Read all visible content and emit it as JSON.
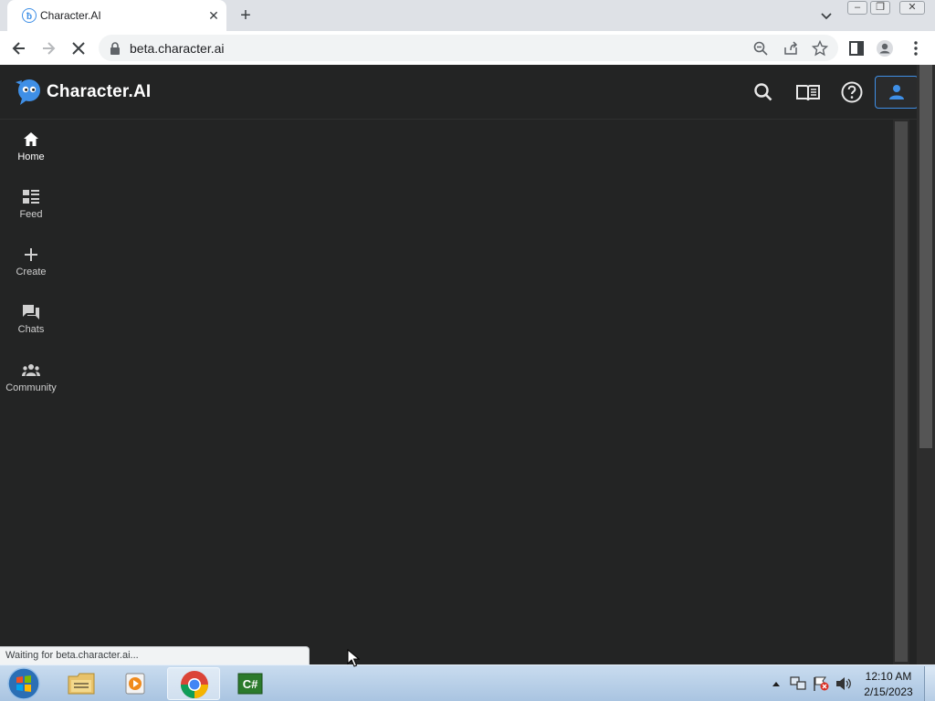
{
  "browser": {
    "tab_title": "Character.AI",
    "tab_close_glyph": "✕",
    "new_tab_glyph": "+",
    "url": "beta.character.ai",
    "status_text": "Waiting for beta.character.ai...",
    "window_buttons": [
      "–",
      "❐",
      "✕"
    ]
  },
  "site": {
    "brand_name": "Character.AI",
    "accent_color": "#3f8fe6",
    "background_color": "#232424",
    "header_icons": [
      "search-icon",
      "book-icon",
      "help-icon",
      "profile-icon"
    ],
    "nav": [
      {
        "label": "Home",
        "icon": "home-icon",
        "active": true
      },
      {
        "label": "Feed",
        "icon": "feed-icon",
        "active": false
      },
      {
        "label": "Create",
        "icon": "plus-icon",
        "active": false
      },
      {
        "label": "Chats",
        "icon": "chats-icon",
        "active": false
      },
      {
        "label": "Community",
        "icon": "community-icon",
        "active": false
      }
    ]
  },
  "taskbar": {
    "time": "12:10 AM",
    "date": "2/15/2023",
    "apps": [
      "start-orb",
      "file-explorer",
      "media-player",
      "chrome",
      "csharp-app"
    ]
  }
}
